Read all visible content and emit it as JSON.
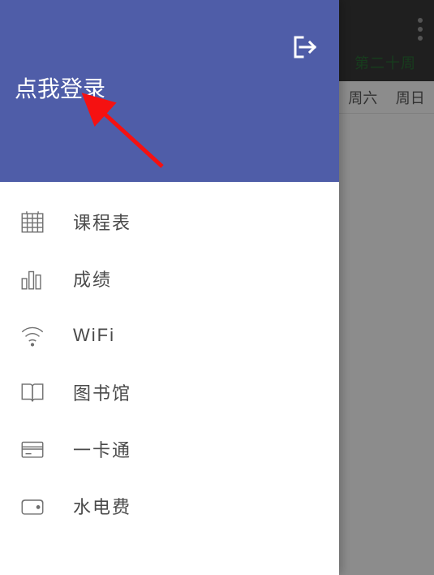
{
  "background": {
    "week_banner": "第二十周",
    "days": [
      "周六",
      "周日"
    ]
  },
  "drawer": {
    "login_prompt": "点我登录",
    "menu": [
      {
        "label": "课程表",
        "icon": "timetable-icon"
      },
      {
        "label": "成绩",
        "icon": "grades-icon"
      },
      {
        "label": "WiFi",
        "icon": "wifi-icon"
      },
      {
        "label": "图书馆",
        "icon": "library-icon"
      },
      {
        "label": "一卡通",
        "icon": "card-icon"
      },
      {
        "label": "水电费",
        "icon": "utilities-icon"
      }
    ]
  },
  "colors": {
    "primary": "#4f5da8",
    "annotation": "#f51111"
  }
}
